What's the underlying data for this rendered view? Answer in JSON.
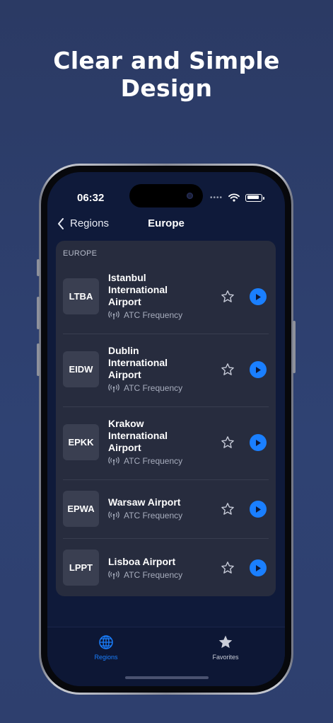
{
  "headline": {
    "line1": "Clear and Simple",
    "line2": "Design"
  },
  "status_bar": {
    "time": "06:32"
  },
  "nav": {
    "back_label": "Regions",
    "title": "Europe"
  },
  "section": {
    "header": "EUROPE"
  },
  "airports": [
    {
      "code": "LTBA",
      "name": "Istanbul International Airport",
      "subtitle": "ATC Frequency"
    },
    {
      "code": "EIDW",
      "name": "Dublin International Airport",
      "subtitle": "ATC Frequency"
    },
    {
      "code": "EPKK",
      "name": "Krakow International Airport",
      "subtitle": "ATC Frequency"
    },
    {
      "code": "EPWA",
      "name": "Warsaw Airport",
      "subtitle": "ATC Frequency"
    },
    {
      "code": "LPPT",
      "name": "Lisboa Airport",
      "subtitle": "ATC Frequency"
    }
  ],
  "tabs": [
    {
      "label": "Regions",
      "icon": "globe-icon",
      "active": true
    },
    {
      "label": "Favorites",
      "icon": "star-icon",
      "active": false
    }
  ],
  "colors": {
    "accent": "#1a7fff",
    "card": "#272c3e",
    "screen": "#0f1a3a"
  }
}
